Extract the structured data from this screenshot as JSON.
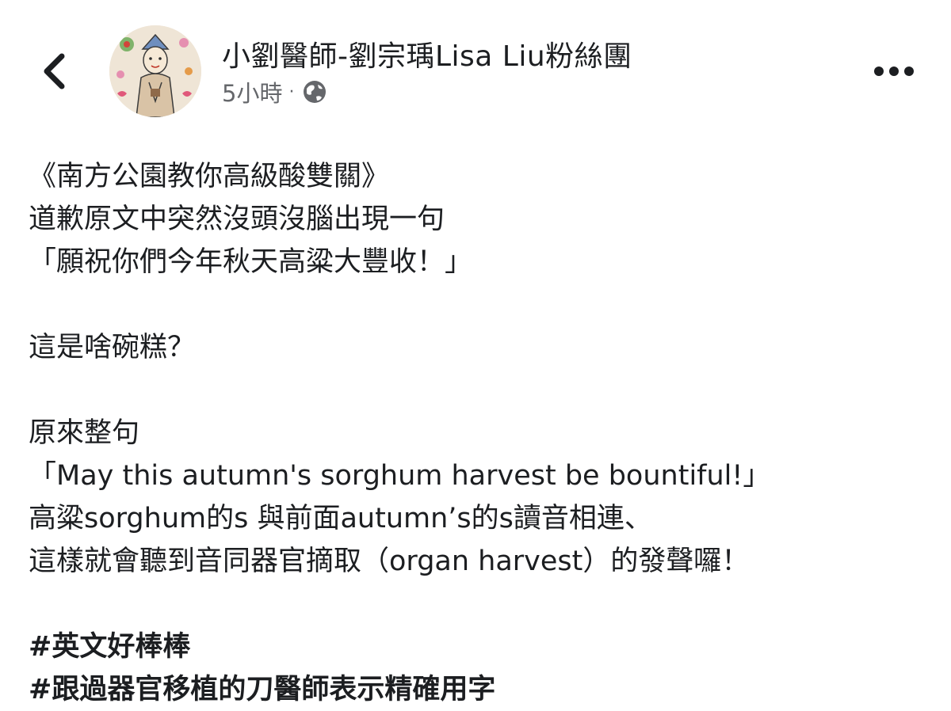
{
  "header": {
    "back_icon": "chevron-left-icon",
    "page_name": "小劉醫師-劉宗瑀Lisa Liu粉絲團",
    "timestamp": "5小時",
    "separator": "·",
    "audience_icon": "globe-icon",
    "more_icon": "ellipsis-icon"
  },
  "post": {
    "lines": [
      "《南方公園教你高級酸雙關》",
      "道歉原文中突然沒頭沒腦出現一句",
      "「願祝你們今年秋天高粱大豐收！」",
      "",
      "這是啥碗糕？",
      "",
      "原來整句",
      "「May this autumn's sorghum harvest be bountiful!」",
      "高粱sorghum的s 與前面autumn’s的s讀音相連、",
      "這樣就會聽到音同器官摘取（organ harvest）的發聲囉！",
      ""
    ],
    "hashtags": [
      "#英文好棒棒",
      "#跟過器官移植的刀醫師表示精確用字"
    ]
  },
  "colors": {
    "text": "#1c1e21",
    "meta": "#65676b"
  }
}
